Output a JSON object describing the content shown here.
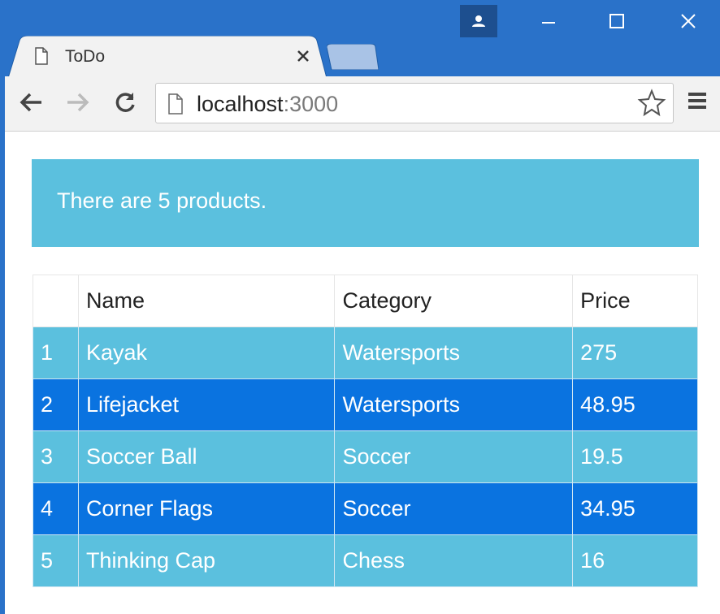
{
  "browser": {
    "tab_title": "ToDo",
    "url_host": "localhost",
    "url_port": ":3000"
  },
  "alert": {
    "text": "There are 5 products."
  },
  "table": {
    "headers": [
      "",
      "Name",
      "Category",
      "Price"
    ],
    "rows": [
      {
        "index": "1",
        "name": "Kayak",
        "category": "Watersports",
        "price": "275"
      },
      {
        "index": "2",
        "name": "Lifejacket",
        "category": "Watersports",
        "price": "48.95"
      },
      {
        "index": "3",
        "name": "Soccer Ball",
        "category": "Soccer",
        "price": "19.5"
      },
      {
        "index": "4",
        "name": "Corner Flags",
        "category": "Soccer",
        "price": "34.95"
      },
      {
        "index": "5",
        "name": "Thinking Cap",
        "category": "Chess",
        "price": "16"
      }
    ]
  },
  "colors": {
    "titlebar": "#2a72c9",
    "info": "#5bc0de",
    "primary": "#0a73e0"
  }
}
